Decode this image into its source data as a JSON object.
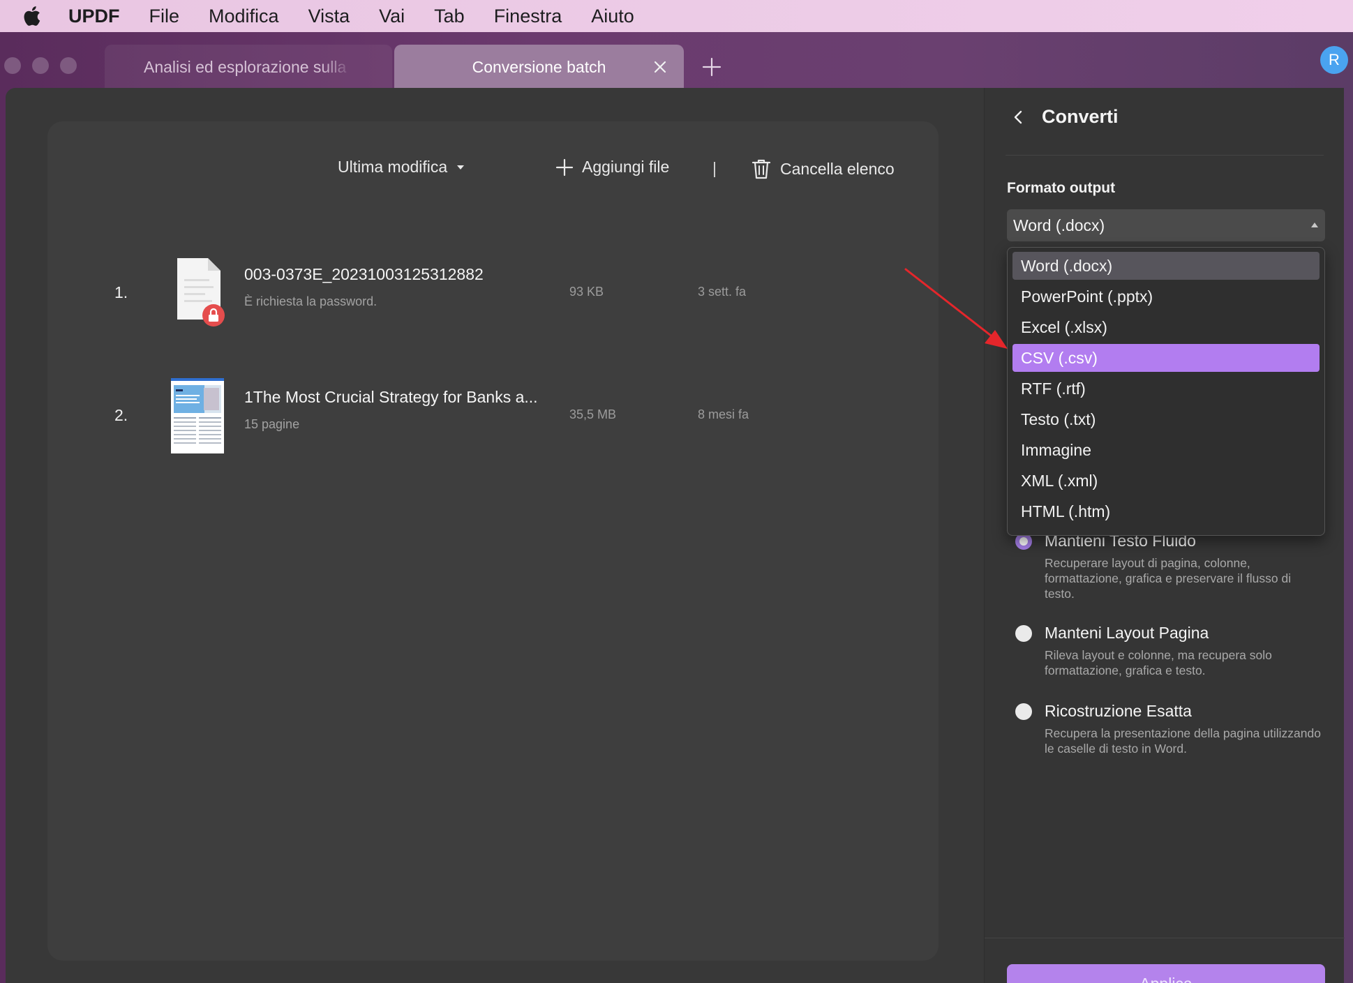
{
  "menubar": {
    "app_name": "UPDF",
    "items": [
      "File",
      "Modifica",
      "Vista",
      "Vai",
      "Tab",
      "Finestra",
      "Aiuto"
    ]
  },
  "tabs": [
    {
      "label": "Analisi ed esplorazione sulla"
    },
    {
      "label": "Conversione batch"
    }
  ],
  "avatar": {
    "initial": "R"
  },
  "toolbar": {
    "sort_label": "Ultima modifica",
    "add_label": "Aggiungi file",
    "clear_label": "Cancella elenco"
  },
  "files": [
    {
      "index": "1.",
      "name": "003-0373E_20231003125312882",
      "sub": "È richiesta la password.",
      "size": "93 KB",
      "date": "3 sett. fa",
      "locked": true
    },
    {
      "index": "2.",
      "name": "1The Most Crucial Strategy for Banks a...",
      "sub": "15 pagine",
      "size": "35,5 MB",
      "date": "8 mesi fa",
      "locked": false
    }
  ],
  "panel": {
    "title": "Converti",
    "format_label": "Formato output",
    "selected_format": "Word (.docx)",
    "format_options": [
      "Word (.docx)",
      "PowerPoint (.pptx)",
      "Excel (.xlsx)",
      "CSV (.csv)",
      "RTF (.rtf)",
      "Testo (.txt)",
      "Immagine",
      "XML (.xml)",
      "HTML (.htm)"
    ],
    "highlighted_option": "CSV (.csv)",
    "layout_options": [
      {
        "title": "Mantieni Testo Fluido",
        "desc": "Recuperare layout di pagina, colonne, formattazione, grafica e preservare il flusso di testo.",
        "selected": true
      },
      {
        "title": "Manteni Layout Pagina",
        "desc": "Rileva layout e colonne, ma recupera solo formattazione, grafica e testo.",
        "selected": false
      },
      {
        "title": "Ricostruzione Esatta",
        "desc": "Recupera la presentazione della pagina utilizzando le caselle di testo in Word.",
        "selected": false
      }
    ],
    "apply_label": "Applica"
  },
  "colors": {
    "accent": "#b483ec",
    "highlight": "#b27df0",
    "lock_badge": "#e54d4d",
    "arrow": "#e5262b"
  }
}
